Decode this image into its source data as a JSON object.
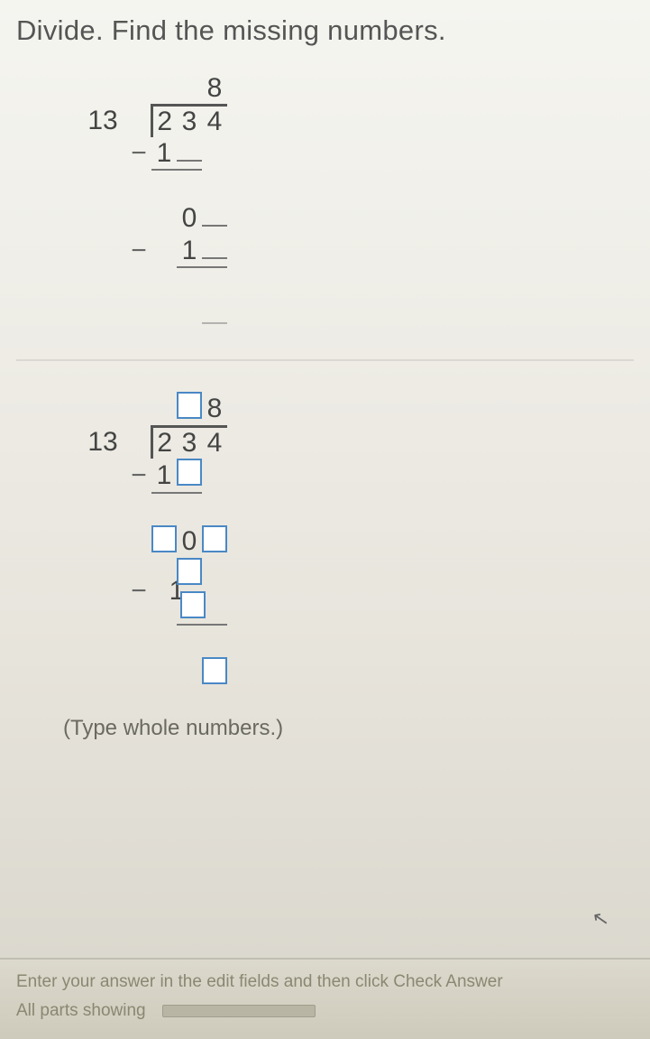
{
  "instruction": "Divide. Find the missing numbers.",
  "problem1": {
    "divisor": "13",
    "dividend": {
      "d1": "2",
      "d2": "3",
      "d3": "4"
    },
    "quotient_digit": "8",
    "step1_minus": "−",
    "step1_val": "1",
    "step2_bring": "0",
    "step3_minus": "−",
    "step3_val": "1"
  },
  "problem2": {
    "divisor": "13",
    "dividend": {
      "d1": "2",
      "d2": "3",
      "d3": "4"
    },
    "quotient_known": "8",
    "step1_minus": "−",
    "step1_val": "1",
    "step2_bring": "0",
    "step3_minus": "−",
    "step3_val": "1"
  },
  "hint": "(Type whole numbers.)",
  "footer": {
    "line1": "Enter your answer in the edit fields and then click Check Answer",
    "line2": "All parts showing"
  },
  "icons": {
    "cursor": "cursor-icon"
  }
}
